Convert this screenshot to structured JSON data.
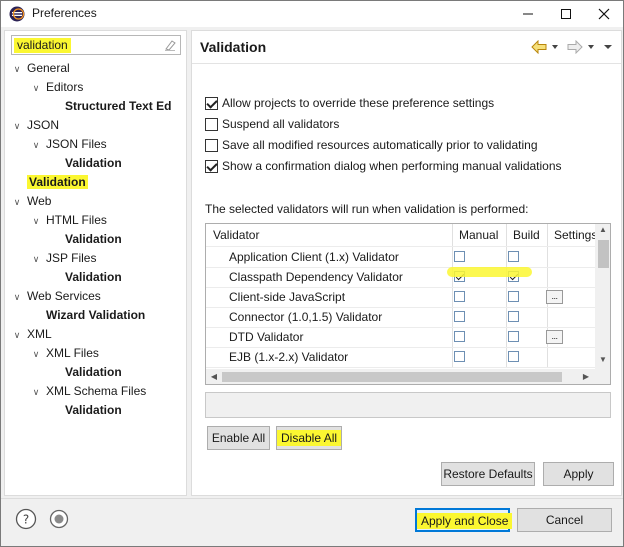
{
  "window": {
    "title": "Preferences",
    "controls": [
      "minimize",
      "maximize",
      "close"
    ]
  },
  "filter": {
    "value": "validation"
  },
  "tree": [
    {
      "label": "General",
      "level": 0,
      "expanded": true,
      "bold": false
    },
    {
      "label": "Editors",
      "level": 1,
      "expanded": true,
      "bold": false
    },
    {
      "label": "Structured Text Ed",
      "level": 2,
      "expanded": null,
      "bold": true
    },
    {
      "label": "JSON",
      "level": 0,
      "expanded": true,
      "bold": false
    },
    {
      "label": "JSON Files",
      "level": 1,
      "expanded": true,
      "bold": false
    },
    {
      "label": "Validation",
      "level": 2,
      "expanded": null,
      "bold": true
    },
    {
      "label": "Validation",
      "level": 0,
      "expanded": null,
      "bold": true,
      "selected": true
    },
    {
      "label": "Web",
      "level": 0,
      "expanded": true,
      "bold": false
    },
    {
      "label": "HTML Files",
      "level": 1,
      "expanded": true,
      "bold": false
    },
    {
      "label": "Validation",
      "level": 2,
      "expanded": null,
      "bold": true
    },
    {
      "label": "JSP Files",
      "level": 1,
      "expanded": true,
      "bold": false
    },
    {
      "label": "Validation",
      "level": 2,
      "expanded": null,
      "bold": true
    },
    {
      "label": "Web Services",
      "level": 0,
      "expanded": true,
      "bold": false
    },
    {
      "label": "Wizard Validation",
      "level": 1,
      "expanded": null,
      "bold": true
    },
    {
      "label": "XML",
      "level": 0,
      "expanded": true,
      "bold": false
    },
    {
      "label": "XML Files",
      "level": 1,
      "expanded": true,
      "bold": false
    },
    {
      "label": "Validation",
      "level": 2,
      "expanded": null,
      "bold": true
    },
    {
      "label": "XML Schema Files",
      "level": 1,
      "expanded": true,
      "bold": false
    },
    {
      "label": "Validation",
      "level": 2,
      "expanded": null,
      "bold": true
    }
  ],
  "page": {
    "title": "Validation",
    "options": [
      {
        "label": "Allow projects to override these preference settings",
        "checked": true
      },
      {
        "label": "Suspend all validators",
        "checked": false
      },
      {
        "label": "Save all modified resources automatically prior to validating",
        "checked": false
      },
      {
        "label": "Show a confirmation dialog when performing manual validations",
        "checked": true
      }
    ],
    "selected_text": "The selected validators will run when validation is performed:",
    "table": {
      "headers": {
        "validator": "Validator",
        "manual": "Manual",
        "build": "Build",
        "settings": "Settings"
      },
      "rows": [
        {
          "name": "Application Client (1.x) Validator",
          "manual": false,
          "build": false,
          "settings": false
        },
        {
          "name": "Classpath Dependency Validator",
          "manual": true,
          "build": true,
          "settings": false
        },
        {
          "name": "Client-side JavaScript",
          "manual": false,
          "build": false,
          "settings": true
        },
        {
          "name": "Connector (1.0,1.5) Validator",
          "manual": false,
          "build": false,
          "settings": false
        },
        {
          "name": "DTD Validator",
          "manual": false,
          "build": false,
          "settings": true
        },
        {
          "name": "EJB (1.x-2.x) Validator",
          "manual": false,
          "build": false,
          "settings": false
        }
      ],
      "settings_button": "..."
    },
    "buttons": {
      "enable_all": "Enable All",
      "disable_all": "Disable All",
      "restore_defaults": "Restore Defaults",
      "apply": "Apply"
    }
  },
  "footer": {
    "apply_and_close": "Apply and Close",
    "cancel": "Cancel"
  },
  "colors": {
    "highlight": "#fbf731",
    "focus_border": "#0078d7"
  }
}
